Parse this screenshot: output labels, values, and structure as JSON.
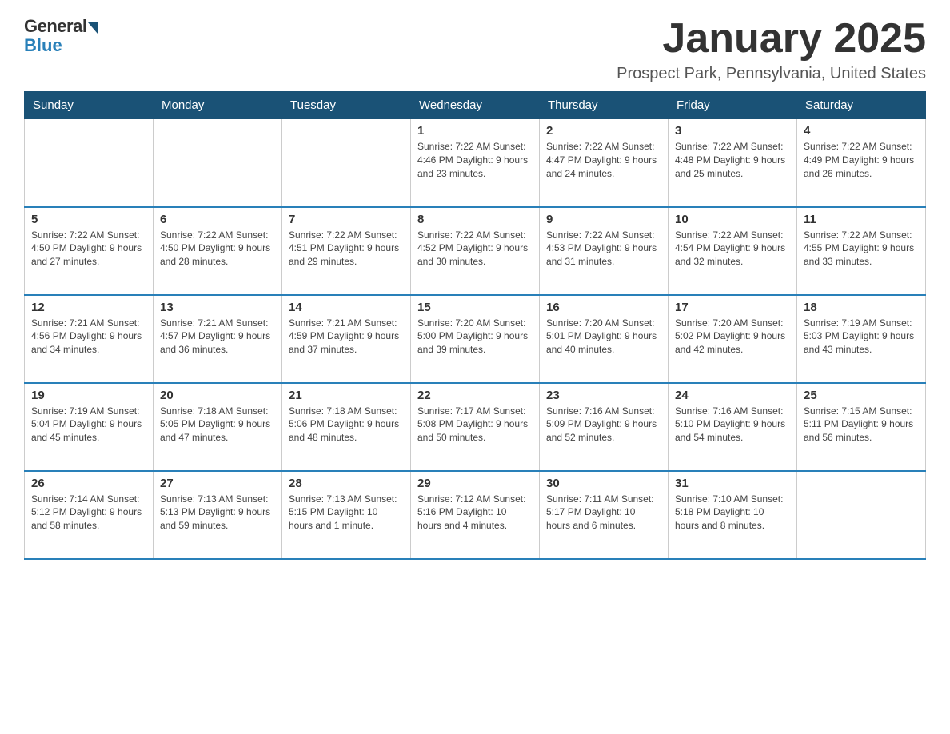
{
  "header": {
    "logo_general": "General",
    "logo_blue": "Blue",
    "month_title": "January 2025",
    "location": "Prospect Park, Pennsylvania, United States"
  },
  "days_of_week": [
    "Sunday",
    "Monday",
    "Tuesday",
    "Wednesday",
    "Thursday",
    "Friday",
    "Saturday"
  ],
  "weeks": [
    [
      {
        "day": "",
        "info": ""
      },
      {
        "day": "",
        "info": ""
      },
      {
        "day": "",
        "info": ""
      },
      {
        "day": "1",
        "info": "Sunrise: 7:22 AM\nSunset: 4:46 PM\nDaylight: 9 hours\nand 23 minutes."
      },
      {
        "day": "2",
        "info": "Sunrise: 7:22 AM\nSunset: 4:47 PM\nDaylight: 9 hours\nand 24 minutes."
      },
      {
        "day": "3",
        "info": "Sunrise: 7:22 AM\nSunset: 4:48 PM\nDaylight: 9 hours\nand 25 minutes."
      },
      {
        "day": "4",
        "info": "Sunrise: 7:22 AM\nSunset: 4:49 PM\nDaylight: 9 hours\nand 26 minutes."
      }
    ],
    [
      {
        "day": "5",
        "info": "Sunrise: 7:22 AM\nSunset: 4:50 PM\nDaylight: 9 hours\nand 27 minutes."
      },
      {
        "day": "6",
        "info": "Sunrise: 7:22 AM\nSunset: 4:50 PM\nDaylight: 9 hours\nand 28 minutes."
      },
      {
        "day": "7",
        "info": "Sunrise: 7:22 AM\nSunset: 4:51 PM\nDaylight: 9 hours\nand 29 minutes."
      },
      {
        "day": "8",
        "info": "Sunrise: 7:22 AM\nSunset: 4:52 PM\nDaylight: 9 hours\nand 30 minutes."
      },
      {
        "day": "9",
        "info": "Sunrise: 7:22 AM\nSunset: 4:53 PM\nDaylight: 9 hours\nand 31 minutes."
      },
      {
        "day": "10",
        "info": "Sunrise: 7:22 AM\nSunset: 4:54 PM\nDaylight: 9 hours\nand 32 minutes."
      },
      {
        "day": "11",
        "info": "Sunrise: 7:22 AM\nSunset: 4:55 PM\nDaylight: 9 hours\nand 33 minutes."
      }
    ],
    [
      {
        "day": "12",
        "info": "Sunrise: 7:21 AM\nSunset: 4:56 PM\nDaylight: 9 hours\nand 34 minutes."
      },
      {
        "day": "13",
        "info": "Sunrise: 7:21 AM\nSunset: 4:57 PM\nDaylight: 9 hours\nand 36 minutes."
      },
      {
        "day": "14",
        "info": "Sunrise: 7:21 AM\nSunset: 4:59 PM\nDaylight: 9 hours\nand 37 minutes."
      },
      {
        "day": "15",
        "info": "Sunrise: 7:20 AM\nSunset: 5:00 PM\nDaylight: 9 hours\nand 39 minutes."
      },
      {
        "day": "16",
        "info": "Sunrise: 7:20 AM\nSunset: 5:01 PM\nDaylight: 9 hours\nand 40 minutes."
      },
      {
        "day": "17",
        "info": "Sunrise: 7:20 AM\nSunset: 5:02 PM\nDaylight: 9 hours\nand 42 minutes."
      },
      {
        "day": "18",
        "info": "Sunrise: 7:19 AM\nSunset: 5:03 PM\nDaylight: 9 hours\nand 43 minutes."
      }
    ],
    [
      {
        "day": "19",
        "info": "Sunrise: 7:19 AM\nSunset: 5:04 PM\nDaylight: 9 hours\nand 45 minutes."
      },
      {
        "day": "20",
        "info": "Sunrise: 7:18 AM\nSunset: 5:05 PM\nDaylight: 9 hours\nand 47 minutes."
      },
      {
        "day": "21",
        "info": "Sunrise: 7:18 AM\nSunset: 5:06 PM\nDaylight: 9 hours\nand 48 minutes."
      },
      {
        "day": "22",
        "info": "Sunrise: 7:17 AM\nSunset: 5:08 PM\nDaylight: 9 hours\nand 50 minutes."
      },
      {
        "day": "23",
        "info": "Sunrise: 7:16 AM\nSunset: 5:09 PM\nDaylight: 9 hours\nand 52 minutes."
      },
      {
        "day": "24",
        "info": "Sunrise: 7:16 AM\nSunset: 5:10 PM\nDaylight: 9 hours\nand 54 minutes."
      },
      {
        "day": "25",
        "info": "Sunrise: 7:15 AM\nSunset: 5:11 PM\nDaylight: 9 hours\nand 56 minutes."
      }
    ],
    [
      {
        "day": "26",
        "info": "Sunrise: 7:14 AM\nSunset: 5:12 PM\nDaylight: 9 hours\nand 58 minutes."
      },
      {
        "day": "27",
        "info": "Sunrise: 7:13 AM\nSunset: 5:13 PM\nDaylight: 9 hours\nand 59 minutes."
      },
      {
        "day": "28",
        "info": "Sunrise: 7:13 AM\nSunset: 5:15 PM\nDaylight: 10 hours\nand 1 minute."
      },
      {
        "day": "29",
        "info": "Sunrise: 7:12 AM\nSunset: 5:16 PM\nDaylight: 10 hours\nand 4 minutes."
      },
      {
        "day": "30",
        "info": "Sunrise: 7:11 AM\nSunset: 5:17 PM\nDaylight: 10 hours\nand 6 minutes."
      },
      {
        "day": "31",
        "info": "Sunrise: 7:10 AM\nSunset: 5:18 PM\nDaylight: 10 hours\nand 8 minutes."
      },
      {
        "day": "",
        "info": ""
      }
    ]
  ]
}
